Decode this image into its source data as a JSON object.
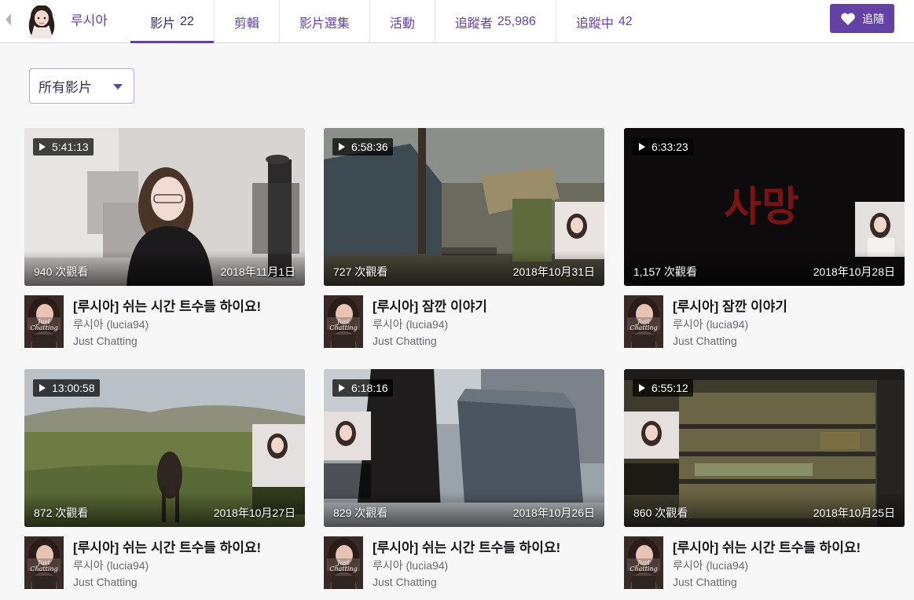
{
  "channel": {
    "name": "루시아"
  },
  "nav": {
    "tabs": [
      {
        "label": "影片",
        "count": "22"
      },
      {
        "label": "剪輯",
        "count": ""
      },
      {
        "label": "影片選集",
        "count": ""
      },
      {
        "label": "活動",
        "count": ""
      },
      {
        "label": "追蹤者",
        "count": "25,986"
      },
      {
        "label": "追蹤中",
        "count": "42"
      }
    ],
    "active_tab": "影片",
    "follow_label": "追隨"
  },
  "filter": {
    "selected": "所有影片"
  },
  "colors": {
    "accent": "#6441a4",
    "page_bg": "#f7f7f8"
  },
  "videos": [
    {
      "duration": "5:41:13",
      "views": "940 次觀看",
      "date": "2018年11月1日",
      "title": "[루시아] 쉬는 시간 트수들 하이요!",
      "author": "루시아 (lucia94)",
      "category": "Just Chatting"
    },
    {
      "duration": "6:58:36",
      "views": "727 次觀看",
      "date": "2018年10月31日",
      "title": "[루시아] 잠깐 이야기",
      "author": "루시아 (lucia94)",
      "category": "Just Chatting"
    },
    {
      "duration": "6:33:23",
      "views": "1,157 次觀看",
      "date": "2018年10月28日",
      "title": "[루시아] 잠깐 이야기",
      "author": "루시아 (lucia94)",
      "category": "Just Chatting",
      "overlay_text": "사망"
    },
    {
      "duration": "13:00:58",
      "views": "872 次觀看",
      "date": "2018年10月27日",
      "title": "[루시아] 쉬는 시간 트수들 하이요!",
      "author": "루시아 (lucia94)",
      "category": "Just Chatting"
    },
    {
      "duration": "6:18:16",
      "views": "829 次觀看",
      "date": "2018年10月26日",
      "title": "[루시아] 쉬는 시간 트수들 하이요!",
      "author": "루시아 (lucia94)",
      "category": "Just Chatting"
    },
    {
      "duration": "6:55:12",
      "views": "860 次觀看",
      "date": "2018年10月25日",
      "title": "[루시아] 쉬는 시간 트수들 하이요!",
      "author": "루시아 (lucia94)",
      "category": "Just Chatting"
    }
  ],
  "icons": {
    "back": "chevron-left-icon",
    "follow": "heart-icon",
    "filter_caret": "caret-down-icon",
    "duration": "play-icon"
  }
}
